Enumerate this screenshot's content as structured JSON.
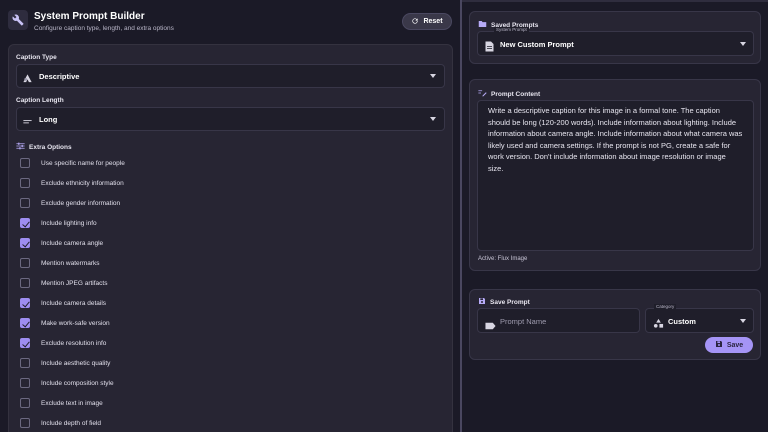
{
  "header": {
    "title": "System Prompt Builder",
    "subtitle": "Configure caption type, length, and extra options",
    "reset_label": "Reset"
  },
  "caption_type": {
    "label": "Caption Type",
    "value": "Descriptive"
  },
  "caption_length": {
    "label": "Caption Length",
    "value": "Long"
  },
  "extra_options": {
    "label": "Extra Options",
    "items": [
      {
        "label": "Use specific name for people",
        "checked": false
      },
      {
        "label": "Exclude ethnicity information",
        "checked": false
      },
      {
        "label": "Exclude gender information",
        "checked": false
      },
      {
        "label": "Include lighting info",
        "checked": true
      },
      {
        "label": "Include camera angle",
        "checked": true
      },
      {
        "label": "Mention watermarks",
        "checked": false
      },
      {
        "label": "Mention JPEG artifacts",
        "checked": false
      },
      {
        "label": "Include camera details",
        "checked": true
      },
      {
        "label": "Make work-safe version",
        "checked": true
      },
      {
        "label": "Exclude resolution info",
        "checked": true
      },
      {
        "label": "Include aesthetic quality",
        "checked": false
      },
      {
        "label": "Include composition style",
        "checked": false
      },
      {
        "label": "Exclude text in image",
        "checked": false
      },
      {
        "label": "Include depth of field",
        "checked": false
      }
    ]
  },
  "saved_prompts": {
    "title": "Saved Prompts",
    "select_legend": "System Prompt",
    "select_value": "New Custom Prompt"
  },
  "prompt_content": {
    "title": "Prompt Content",
    "text": "Write a descriptive caption for this image in a formal tone. The caption should be long (120-200 words). Include information about lighting. Include information about camera angle. Include information about what camera was likely used and camera settings. If the prompt is not PG, create a safe for work version. Don't include information about image resolution or image size.",
    "active_label": "Active: Flux Image"
  },
  "save_prompt": {
    "title": "Save Prompt",
    "name_placeholder": "Prompt Name",
    "category_legend": "Category",
    "category_value": "Custom",
    "save_label": "Save"
  },
  "colors": {
    "background": "#1b1a27",
    "card": "#272533",
    "accent": "#a594f6",
    "checkbox_on": "#9d8df0"
  }
}
